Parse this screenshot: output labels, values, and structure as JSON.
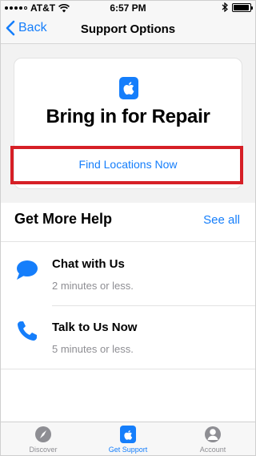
{
  "status_bar": {
    "carrier": "AT&T",
    "time": "6:57 PM"
  },
  "nav": {
    "back_label": "Back",
    "title": "Support Options"
  },
  "repair_card": {
    "title": "Bring in for Repair",
    "link": "Find Locations Now"
  },
  "more_help": {
    "header": "Get More Help",
    "see_all": "See all",
    "items": [
      {
        "title": "Chat with Us",
        "subtitle": "2 minutes or less.",
        "icon": "chat-bubble-icon"
      },
      {
        "title": "Talk to Us Now",
        "subtitle": "5 minutes or less.",
        "icon": "phone-icon"
      }
    ]
  },
  "tabs": [
    {
      "label": "Discover",
      "icon": "compass-icon",
      "active": false
    },
    {
      "label": "Get Support",
      "icon": "apple-support-icon",
      "active": true
    },
    {
      "label": "Account",
      "icon": "person-icon",
      "active": false
    }
  ],
  "colors": {
    "accent": "#157efb",
    "highlight": "#d61f26",
    "secondary_text": "#8e8e93"
  }
}
